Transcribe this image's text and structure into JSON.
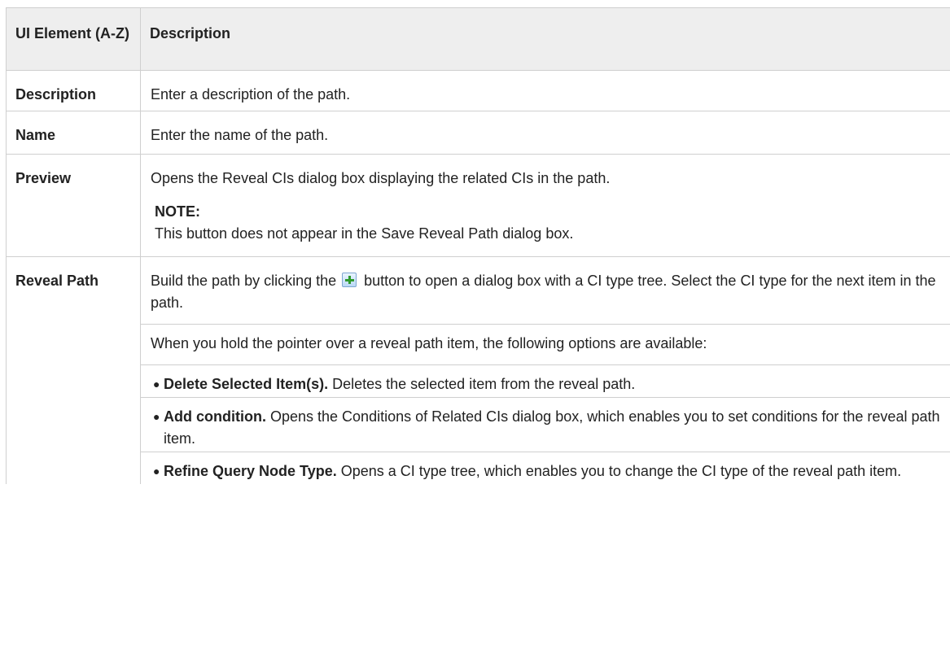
{
  "table": {
    "headers": {
      "element": "UI Element (A-Z)",
      "description": "Description"
    },
    "rows": {
      "description": {
        "term": "Description",
        "text": "Enter a description of the path."
      },
      "name": {
        "term": "Name",
        "text": "Enter the name of the path."
      },
      "preview": {
        "term": "Preview",
        "text": "Opens the Reveal CIs dialog box displaying the related CIs in the path.",
        "note_label": "NOTE:",
        "note_text": "This button does not appear in the Save Reveal Path dialog box."
      },
      "reveal_path": {
        "term": "Reveal Path",
        "text_before_icon": "Build the path by clicking the",
        "text_after_icon": "button to open a dialog box with a CI type tree. Select the CI type for the next item in the path.",
        "icon": "add-plus-icon",
        "intro": "When you hold the pointer over a reveal path item, the following options are available:",
        "options": [
          {
            "label": "Delete Selected Item(s).",
            "text": "Deletes the selected item from the reveal path."
          },
          {
            "label": "Add condition.",
            "text": "Opens the Conditions of Related CIs dialog box, which enables you to set conditions for the reveal path item."
          },
          {
            "label": "Refine Query Node Type.",
            "text": "Opens a CI type tree, which enables you to change the CI type of the reveal path item."
          }
        ]
      }
    }
  }
}
